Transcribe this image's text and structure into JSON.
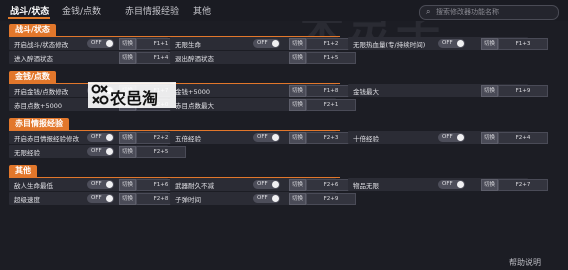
{
  "watermark": "木灵子",
  "tabs": [
    "战斗/状态",
    "金钱/点数",
    "赤目情报经验",
    "其他"
  ],
  "search": {
    "placeholder": "搜索修改器功能名称"
  },
  "brand": {
    "logo_text": "农邑淘"
  },
  "help_label": "帮助说明",
  "hotkey_action_label": "切换",
  "toggle_label": "OFF",
  "sections": [
    {
      "title": "战斗/状态",
      "rows": [
        [
          {
            "label": "开启战斗/状态修改",
            "toggle": true,
            "key": "F1+1"
          },
          {
            "label": "无限生命",
            "toggle": true,
            "key": "F1+2"
          },
          {
            "label": "无限热血量(专/持续时间)",
            "toggle": true,
            "key": "F1+3"
          }
        ],
        [
          {
            "label": "进入醉酒状态",
            "toggle": false,
            "key": "F1+4"
          },
          {
            "label": "退出醉酒状态",
            "toggle": false,
            "key": "F1+5"
          }
        ]
      ]
    },
    {
      "title": "金钱/点数",
      "rows": [
        [
          {
            "label": "开启金钱/点数修改",
            "toggle": true,
            "key": "F1+7"
          },
          {
            "label": "金钱+5000",
            "toggle": false,
            "key": "F1+8"
          },
          {
            "label": "金钱最大",
            "toggle": false,
            "key": "F1+9"
          }
        ],
        [
          {
            "label": "赤目点数+5000",
            "toggle": false,
            "key": "F2+0"
          },
          {
            "label": "赤目点数最大",
            "toggle": false,
            "key": "F2+1"
          }
        ]
      ]
    },
    {
      "title": "赤目情报经验",
      "rows": [
        [
          {
            "label": "开启赤目情报经验修改",
            "toggle": true,
            "key": "F2+2"
          },
          {
            "label": "五倍经验",
            "toggle": true,
            "key": "F2+3"
          },
          {
            "label": "十倍经验",
            "toggle": true,
            "key": "F2+4"
          }
        ],
        [
          {
            "label": "无限经验",
            "toggle": true,
            "key": "F2+5"
          }
        ]
      ]
    },
    {
      "title": "其他",
      "rows": [
        [
          {
            "label": "敌人生命最低",
            "toggle": true,
            "key": "F1+6"
          },
          {
            "label": "武器耐久不减",
            "toggle": true,
            "key": "F2+6"
          },
          {
            "label": "物品无限",
            "toggle": true,
            "key": "F2+7"
          }
        ],
        [
          {
            "label": "超级速度",
            "toggle": true,
            "key": "F2+8"
          },
          {
            "label": "子弹时间",
            "toggle": true,
            "key": "F2+9"
          }
        ]
      ]
    }
  ]
}
